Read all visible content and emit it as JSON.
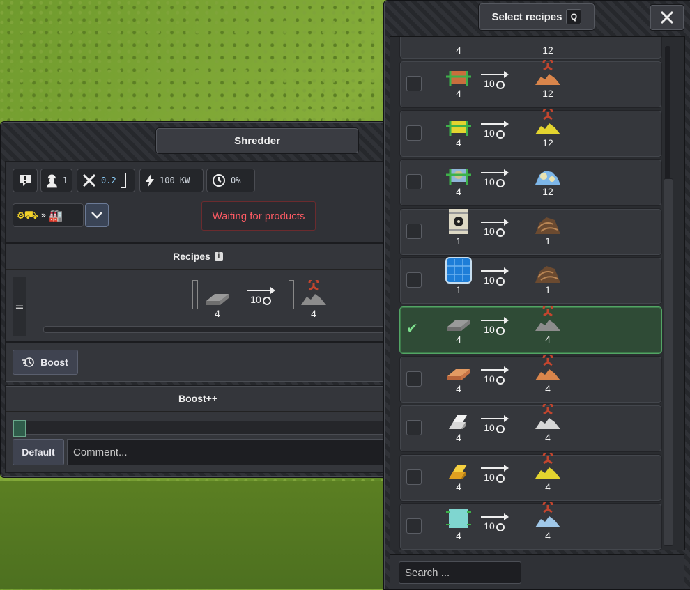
{
  "shredder_window": {
    "title": "Shredder",
    "status_bar": {
      "workers": "1",
      "maintenance": "0.2",
      "power": "100 KW",
      "utilization": "0%"
    },
    "tooltip": "Waiting for products",
    "recipes_section": {
      "title": "Recipes",
      "recipe": {
        "input_qty": "4",
        "duration": "10",
        "output_qty": "4"
      }
    },
    "boost_button": "Boost",
    "boostpp_section": {
      "title": "Boost++",
      "slider_value": 0
    },
    "default_button": "Default",
    "comment_placeholder": "Comment..."
  },
  "recipe_selector": {
    "title": "Select recipes",
    "hotkey": "Q",
    "close_label": "✕",
    "partial_row": {
      "input_qty": "4",
      "output_qty": "12"
    },
    "rows": [
      {
        "input_icon": "orange-ore-crate-icon",
        "input_qty": "4",
        "duration": "10",
        "output_icon": "orange-shredded-pile-icon",
        "output_qty": "12",
        "selected": false
      },
      {
        "input_icon": "yellow-ore-crate-icon",
        "input_qty": "4",
        "duration": "10",
        "output_icon": "yellow-shredded-pile-icon",
        "output_qty": "12",
        "selected": false
      },
      {
        "input_icon": "mixed-crate-icon",
        "input_qty": "4",
        "duration": "10",
        "output_icon": "blue-rock-pile-icon",
        "output_qty": "12",
        "selected": false
      },
      {
        "input_icon": "radioactive-barrel-icon",
        "input_qty": "1",
        "duration": "10",
        "output_icon": "scrap-pile-icon",
        "output_qty": "1",
        "selected": false
      },
      {
        "input_icon": "solar-panel-icon",
        "input_qty": "1",
        "duration": "10",
        "output_icon": "scrap-pile-icon",
        "output_qty": "1",
        "selected": false
      },
      {
        "input_icon": "steel-plate-icon",
        "input_qty": "4",
        "duration": "10",
        "output_icon": "grey-shredded-pile-icon",
        "output_qty": "4",
        "selected": true
      },
      {
        "input_icon": "copper-plate-icon",
        "input_qty": "4",
        "duration": "10",
        "output_icon": "orange-shredded-pile-icon",
        "output_qty": "4",
        "selected": false
      },
      {
        "input_icon": "aluminium-ingot-icon",
        "input_qty": "4",
        "duration": "10",
        "output_icon": "white-shredded-pile-icon",
        "output_qty": "4",
        "selected": false
      },
      {
        "input_icon": "gold-ingot-icon",
        "input_qty": "4",
        "duration": "10",
        "output_icon": "yellow-shredded-pile-icon",
        "output_qty": "4",
        "selected": false
      },
      {
        "input_icon": "glass-block-icon",
        "input_qty": "4",
        "duration": "10",
        "output_icon": "light-blue-shredded-pile-icon",
        "output_qty": "4",
        "selected": false
      }
    ],
    "search_placeholder": "Search ..."
  },
  "colors": {
    "selected_row": "#2f4b36",
    "selected_border": "#53a565",
    "tooltip_text": "#ff5b64",
    "claw": "#c2452e"
  }
}
